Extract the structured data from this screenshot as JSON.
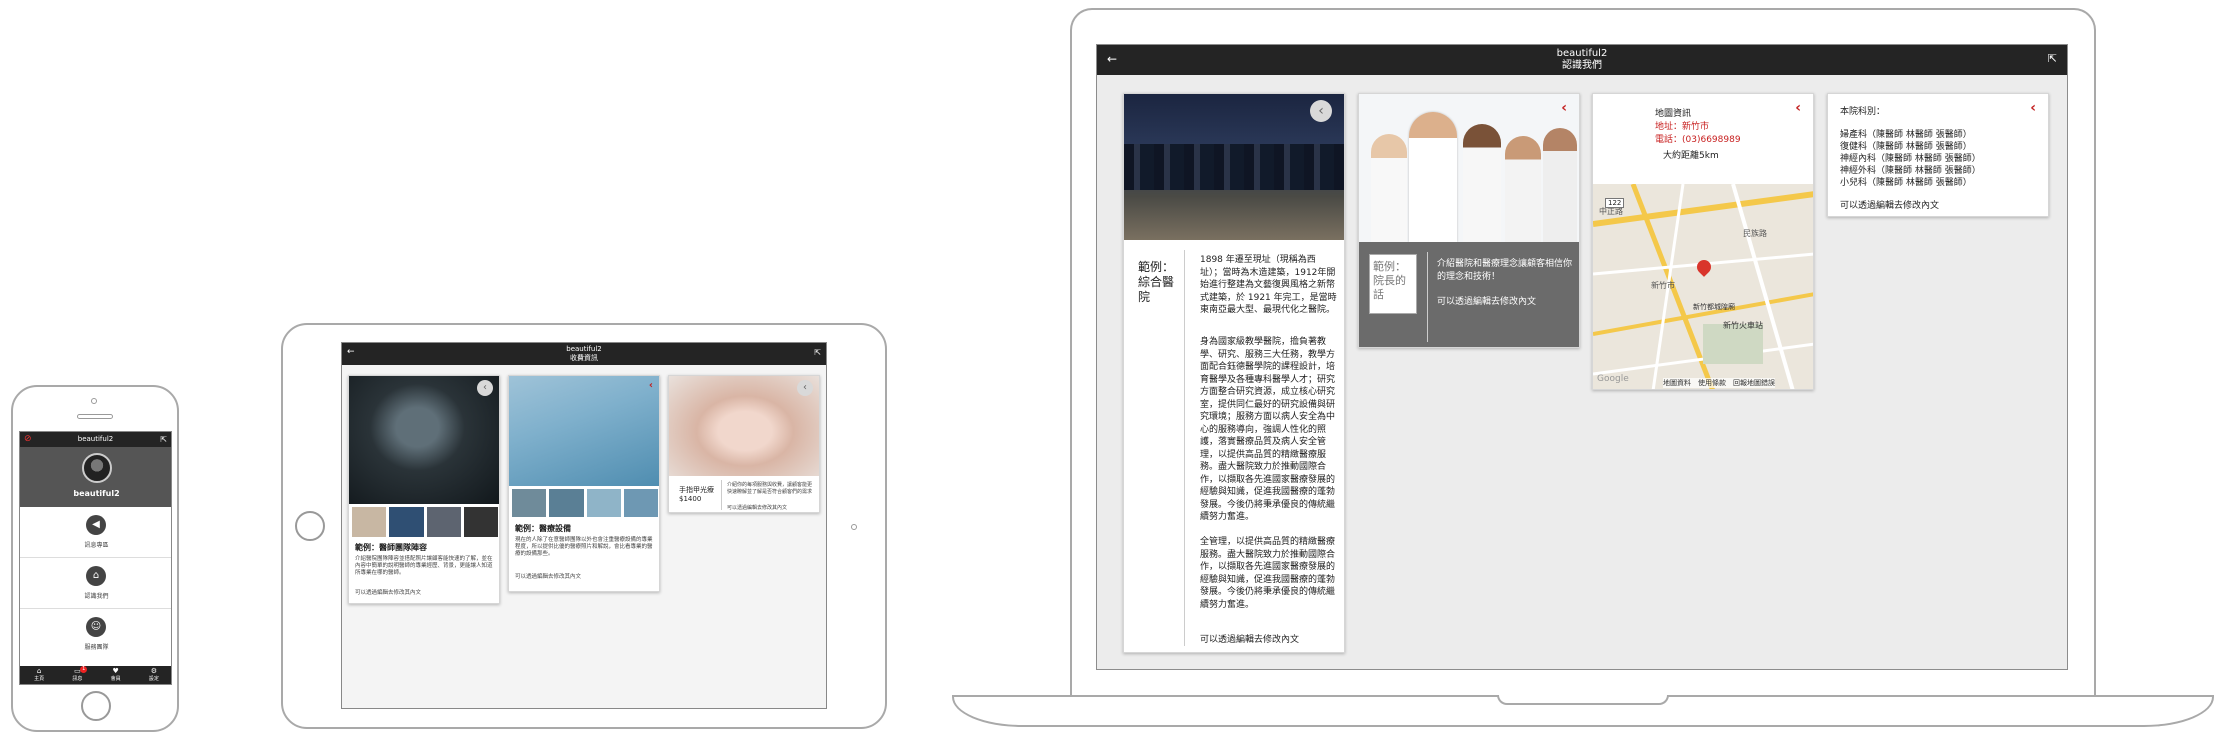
{
  "phone": {
    "app_title": "beautiful2",
    "profile_name": "beautiful2",
    "menu": [
      {
        "label": "訊息專區",
        "icon": "megaphone-icon"
      },
      {
        "label": "認識我們",
        "icon": "hospital-icon"
      },
      {
        "label": "服務團隊",
        "icon": "team-icon"
      }
    ],
    "tabs": [
      {
        "label": "主頁",
        "icon": "home-icon"
      },
      {
        "label": "訊息",
        "icon": "chat-icon"
      },
      {
        "label": "會員",
        "icon": "heart-icon"
      },
      {
        "label": "設定",
        "icon": "gear-icon"
      }
    ],
    "badge": "1"
  },
  "tablet": {
    "app_title": "beautiful2",
    "page_title": "收費資訊",
    "cards": [
      {
        "title": "範例：醫師團隊陣容",
        "desc": "介紹醫院團隊陣容並搭配照片讓顧客能快速的了解，並在內容中簡單的說明醫師的專業經歷、背景，更能讓人知道所專業在哪的醫師。",
        "edit": "可以透過編輯去修改其內文"
      },
      {
        "title": "範例：醫療設備",
        "desc": "現在的人除了在意醫師團隊以外也會注重醫療設備的專業程度，所以提供比優的醫療照片和解說，會比看專業的醫療的設備那些。",
        "edit": "可以透過編輯去修改其內文"
      },
      {
        "title": "手指甲光療\n$1400",
        "desc": "介紹你的每項服務與收費，讓顧客能更快速瞭解並了解是否符合顧客們的需求",
        "edit": "可以透過編輯去修改其內文"
      }
    ]
  },
  "laptop": {
    "app_title": "beautiful2",
    "page_title": "認識我們",
    "card1": {
      "title": "範例：\n綜合醫\n院",
      "body1": "1898 年遷至現址（現稱為西址）；當時為木造建築，1912年開始進行整建為文藝復興風格之新幣式建築，於 1921 年完工，是當時東南亞最大型、最現代化之醫院。",
      "body2": "身為國家級教學醫院，擔負著教學、研究、服務三大任務，教學方面配合鈺德醫學院的課程設計，培育醫學及各種專科醫學人才；研究方面整合研究資源，成立核心研究室，提供同仁最好的研究設備與研究環境；服務方面以病人安全為中心的服務導向，強調人性化的照護，落實醫療品質及病人安全管理，以提供高品質的精緻醫療服務。盡大醫院致力於推動國際合作，以擷取各先進國家醫療發展的經驗與知識，促進我國醫療的蓬勃發展。今後仍將秉承優良的傳統繼續努力奮進。",
      "body3": "全管理，以提供高品質的精緻醫療服務。盡大醫院致力於推動國際合作，以擷取各先進國家醫療發展的經驗與知識，促進我國醫療的蓬勃發展。今後仍將秉承優良的傳統繼續努力奮進。",
      "edit": "可以透過編輯去修改內文"
    },
    "card2": {
      "title": "範例：\n院長的\n話",
      "desc": "介紹醫院和醫療理念讓顧客相信你的理念和技術！",
      "edit": "可以透過編輯去修改內文"
    },
    "card3": {
      "heading": "地圖資訊",
      "address": "地址：新竹市",
      "phone": "電話：(03)6698989",
      "distance": "大約距離5km",
      "map_labels": [
        "中正路",
        "民族路",
        "新竹市",
        "新竹火車站",
        "新竹都城隍廟",
        "122"
      ],
      "map_brand": "Google",
      "map_footer": "地圖資料　使用條款　回報地圖錯誤"
    },
    "card4": {
      "heading": "本院科別：",
      "items": [
        "婦產科（陳醫師 林醫師 張醫師）",
        "復健科（陳醫師 林醫師 張醫師）",
        "神經內科（陳醫師 林醫師 張醫師）",
        "神經外科（陳醫師 林醫師 張醫師）",
        "小兒科（陳醫師 林醫師 張醫師）"
      ],
      "edit": "可以透過編輯去修改內文"
    }
  },
  "colors": {
    "bar": "#242424",
    "accent": "#c82121",
    "gray_panel": "#6b6b6b"
  }
}
